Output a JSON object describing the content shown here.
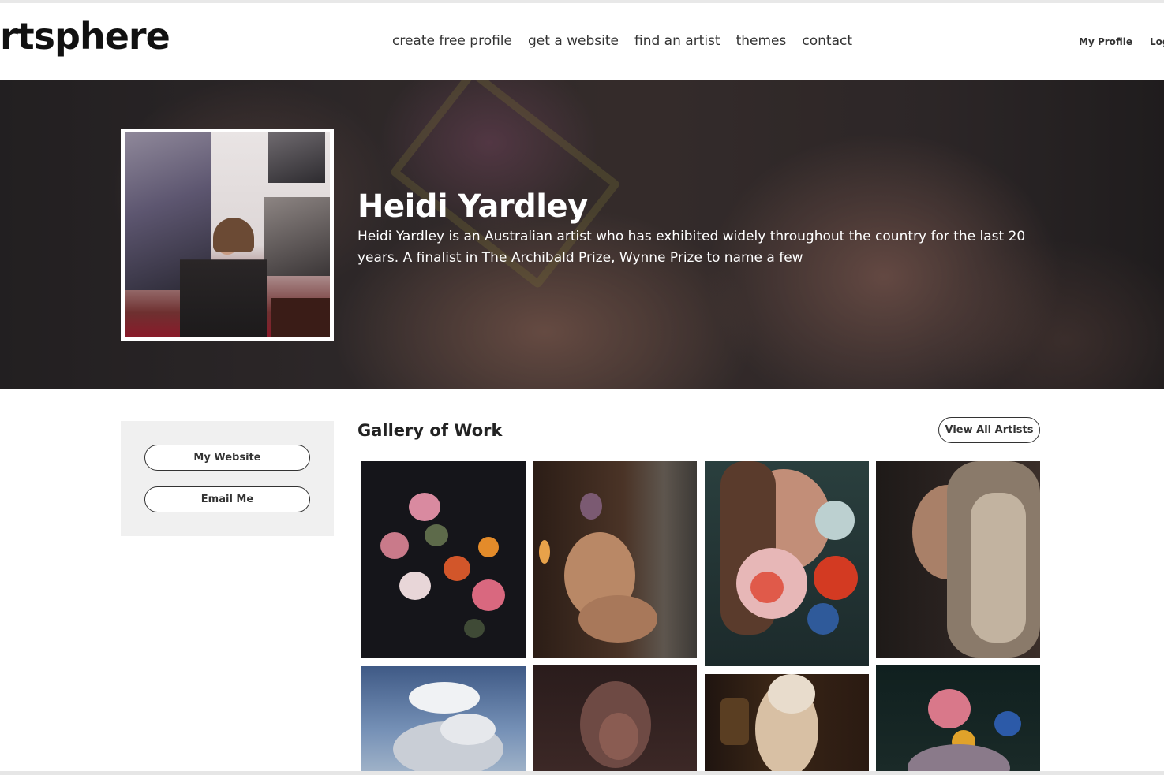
{
  "header": {
    "logo": "rtsphere",
    "nav": [
      {
        "label": "create free profile"
      },
      {
        "label": "get a website"
      },
      {
        "label": "find an artist"
      },
      {
        "label": "themes"
      },
      {
        "label": "contact"
      }
    ],
    "account": {
      "profile_label": "My Profile",
      "login_label": "Log"
    }
  },
  "hero": {
    "name": "Heidi Yardley",
    "bio": "Heidi Yardley is an Australian artist who has exhibited widely throughout the country for the last 20 years. A finalist in The Archibald Prize, Wynne Prize to name a few"
  },
  "sidebar": {
    "website_label": "My Website",
    "email_label": "Email Me"
  },
  "gallery": {
    "title": "Gallery of Work",
    "view_all_label": "View All Artists",
    "artworks": [
      {
        "subject": "flower still life"
      },
      {
        "subject": "nude figure in doorway"
      },
      {
        "subject": "woman with roses"
      },
      {
        "subject": "portrait of blonde woman"
      },
      {
        "subject": "clouds in blue sky"
      },
      {
        "subject": "dark figure study"
      },
      {
        "subject": "figure with pearls"
      },
      {
        "subject": "rose still life"
      }
    ]
  },
  "colors": {
    "text": "#222222",
    "hero_overlay": "#2a2728",
    "sidebar_bg": "#f0f0f0"
  }
}
